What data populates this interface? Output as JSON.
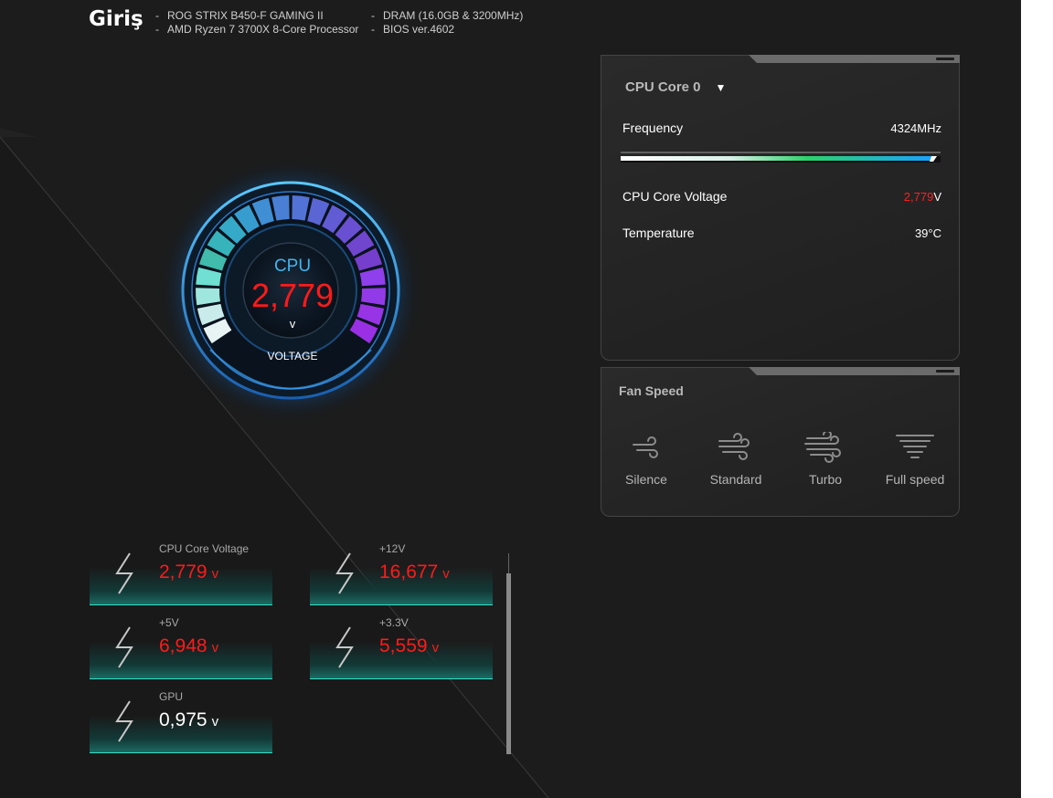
{
  "header": {
    "title": "Giriş",
    "specs": [
      "ROG STRIX B450-F GAMING II",
      "AMD Ryzen 7 3700X 8-Core Processor",
      "DRAM (16.0GB & 3200MHz)",
      "BIOS ver.4602"
    ]
  },
  "gauge": {
    "label": "CPU",
    "value": "2,779",
    "unit": "v",
    "caption": "VOLTAGE"
  },
  "cpu_panel": {
    "selected_core": "CPU Core 0",
    "rows": {
      "frequency": {
        "label": "Frequency",
        "value": "4324MHz"
      },
      "voltage": {
        "label": "CPU Core Voltage",
        "value": "2,779",
        "unit": "V"
      },
      "temperature": {
        "label": "Temperature",
        "value": "39°C"
      }
    }
  },
  "fan_panel": {
    "title": "Fan Speed",
    "modes": [
      "Silence",
      "Standard",
      "Turbo",
      "Full speed"
    ]
  },
  "voltages": [
    {
      "label": "CPU Core Voltage",
      "value": "2,779",
      "unit": "v"
    },
    {
      "label": "+12V",
      "value": "16,677",
      "unit": "v"
    },
    {
      "label": "+5V",
      "value": "6,948",
      "unit": "v"
    },
    {
      "label": "+3.3V",
      "value": "5,559",
      "unit": "v"
    },
    {
      "label": "GPU",
      "value": "0,975",
      "unit": "v"
    }
  ],
  "colors": {
    "accent_cyan": "#34e0c6",
    "alert_red": "#ff1a1a",
    "gauge_blue": "#3fb6f0"
  }
}
